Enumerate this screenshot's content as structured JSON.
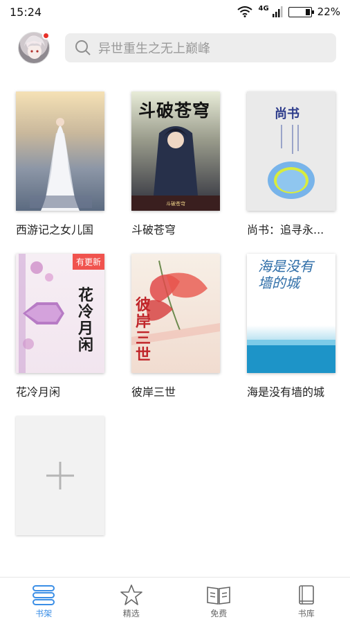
{
  "status_bar": {
    "time": "15:24",
    "network": "4G",
    "battery_percent": "22%",
    "battery_level": 0.22
  },
  "search": {
    "placeholder": "异世重生之无上巅峰"
  },
  "books": [
    {
      "title": "西游记之女儿国",
      "cover_text": "",
      "badge": ""
    },
    {
      "title": "斗破苍穹",
      "cover_text": "斗破苍穹",
      "badge": ""
    },
    {
      "title": "尚书：追寻永...",
      "cover_text": "尚书",
      "badge": ""
    },
    {
      "title": "花冷月闲",
      "cover_text": "花冷月闲",
      "badge": "有更新"
    },
    {
      "title": "彼岸三世",
      "cover_text": "彼岸三世",
      "badge": ""
    },
    {
      "title": "海是没有墙的城",
      "cover_text": "海是没有墙的城",
      "badge": ""
    }
  ],
  "tabs": [
    {
      "label": "书架",
      "icon": "bookshelf-icon",
      "active": true
    },
    {
      "label": "精选",
      "icon": "star-icon",
      "active": false
    },
    {
      "label": "免费",
      "icon": "open-book-icon",
      "active": false
    },
    {
      "label": "书库",
      "icon": "library-icon",
      "active": false
    }
  ],
  "colors": {
    "accent": "#3a8ee6",
    "badge": "#f0534e",
    "search_bg": "#ededed"
  }
}
